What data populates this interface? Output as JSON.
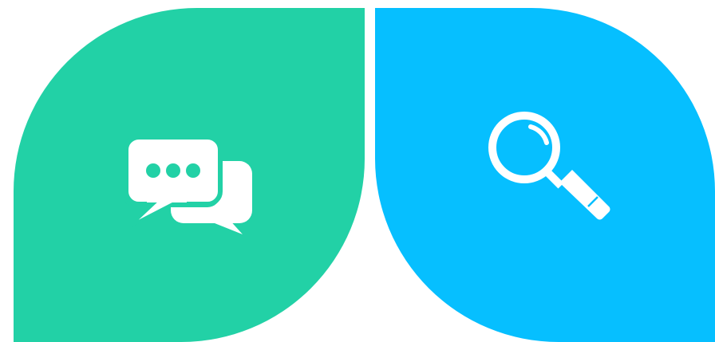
{
  "tiles": [
    {
      "name": "chat-tile",
      "color": "#22D1A6",
      "icon": "chat-bubbles-icon"
    },
    {
      "name": "search-tile",
      "color": "#06BFFF",
      "icon": "magnifying-glass-icon"
    }
  ]
}
